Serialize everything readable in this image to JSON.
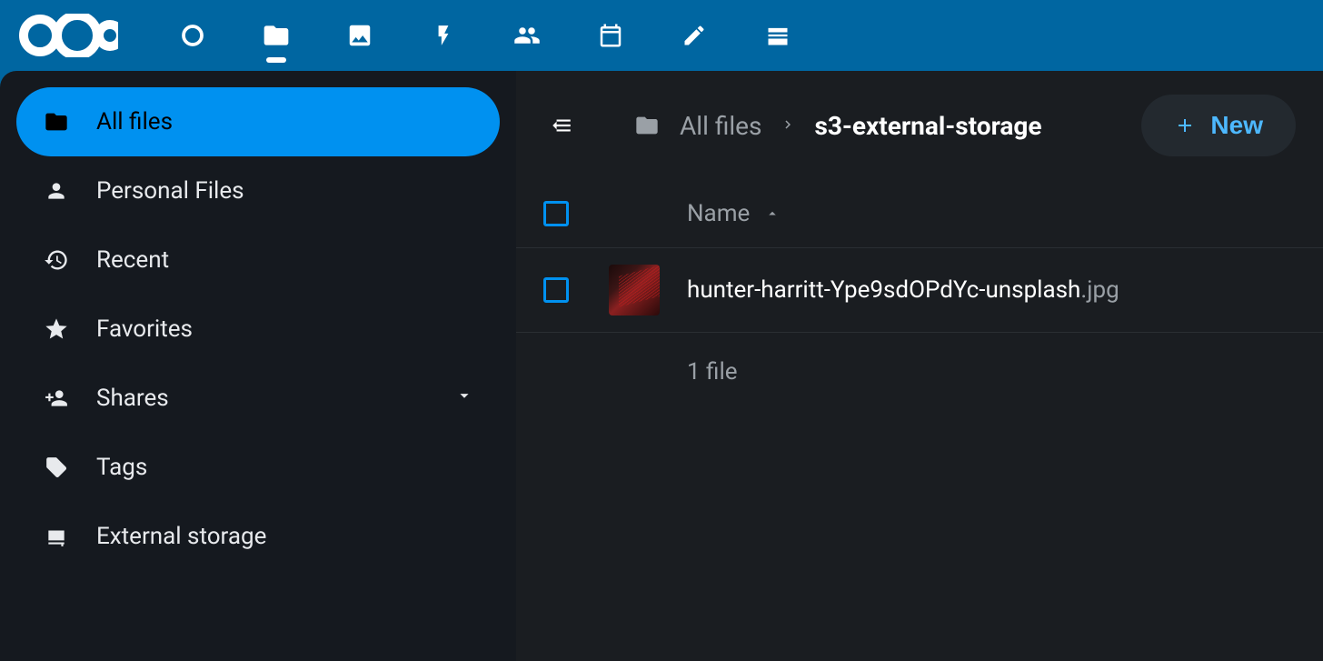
{
  "sidebar": {
    "items": [
      {
        "label": "All files",
        "active": true
      },
      {
        "label": "Personal Files"
      },
      {
        "label": "Recent"
      },
      {
        "label": "Favorites"
      },
      {
        "label": "Shares",
        "expandable": true
      },
      {
        "label": "Tags"
      },
      {
        "label": "External storage"
      }
    ]
  },
  "breadcrumb": {
    "root": "All files",
    "current": "s3-external-storage"
  },
  "header": {
    "new_button_label": "New"
  },
  "table": {
    "columns": {
      "name": "Name"
    },
    "files": [
      {
        "name": "hunter-harritt-Ype9sdOPdYc-unsplash",
        "ext": ".jpg"
      }
    ],
    "summary": "1 file"
  }
}
